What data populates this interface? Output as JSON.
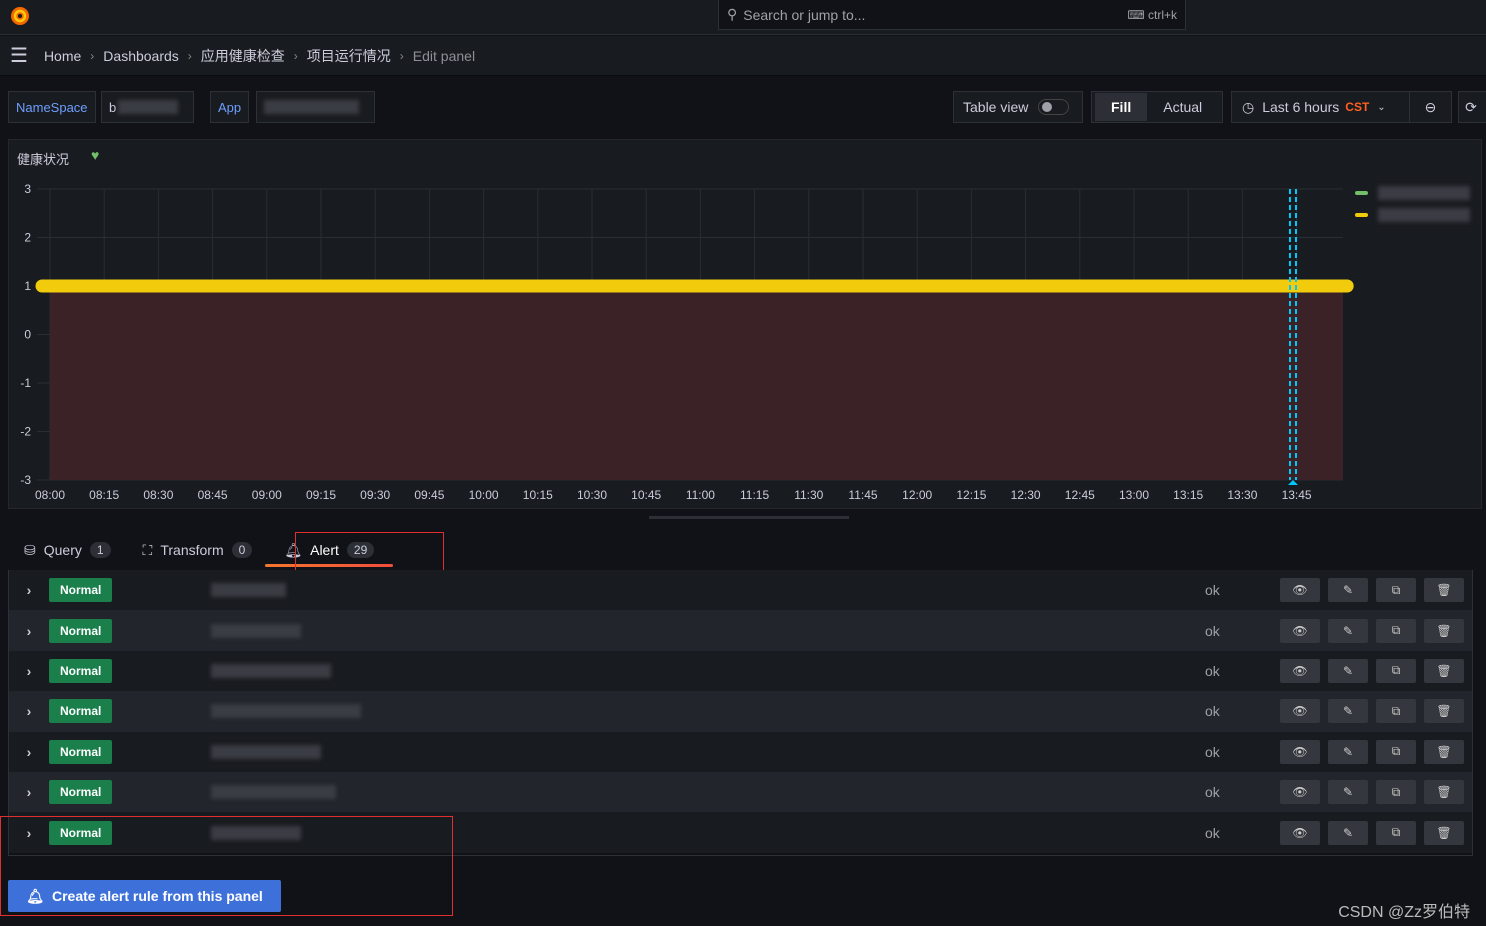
{
  "topbar": {
    "search_placeholder": "Search or jump to...",
    "shortcut": "ctrl+k"
  },
  "breadcrumb": [
    "Home",
    "Dashboards",
    "应用健康检查",
    "项目运行情况",
    "Edit panel"
  ],
  "variables": [
    {
      "label": "NameSpace",
      "value": "b"
    },
    {
      "label": "App",
      "value": ""
    }
  ],
  "toolbar": {
    "table_view": "Table view",
    "table_view_on": false,
    "fill": "Fill",
    "actual": "Actual",
    "time_range": "Last 6 hours",
    "timezone": "CST"
  },
  "panel": {
    "title": "健康状况",
    "status_color": "#73bf69"
  },
  "chart_data": {
    "type": "line",
    "x_ticks": [
      "08:00",
      "08:15",
      "08:30",
      "08:45",
      "09:00",
      "09:15",
      "09:30",
      "09:45",
      "10:00",
      "10:15",
      "10:30",
      "10:45",
      "11:00",
      "11:15",
      "11:30",
      "11:45",
      "12:00",
      "12:15",
      "12:30",
      "12:45",
      "13:00",
      "13:15",
      "13:30",
      "13:45"
    ],
    "y_ticks": [
      3,
      2,
      1,
      0,
      -1,
      -2,
      -3
    ],
    "ylim": [
      -3,
      3
    ],
    "grid": true,
    "series": [
      {
        "color": "#f2cc0c",
        "x_start": "08:00",
        "x_end": "13:59",
        "value": 1,
        "fill_below": "#3a2226"
      }
    ],
    "annotation": {
      "type": "vertical-dashed",
      "x": "13:44",
      "color": "#00c8ff"
    },
    "legend": {
      "placement": "right",
      "colors": [
        "#73bf69",
        "#f2cc0c"
      ]
    }
  },
  "tabs": [
    {
      "label": "Query",
      "count": "1"
    },
    {
      "label": "Transform",
      "count": "0"
    },
    {
      "label": "Alert",
      "count": "29",
      "active": true
    }
  ],
  "alerts": [
    {
      "state": "Normal",
      "health": "ok"
    },
    {
      "state": "Normal",
      "health": "ok"
    },
    {
      "state": "Normal",
      "health": "ok"
    },
    {
      "state": "Normal",
      "health": "ok"
    },
    {
      "state": "Normal",
      "health": "ok"
    },
    {
      "state": "Normal",
      "health": "ok"
    },
    {
      "state": "Normal",
      "health": "ok"
    }
  ],
  "create_button": "Create alert rule from this panel",
  "watermark": "CSDN @Zz罗伯特"
}
